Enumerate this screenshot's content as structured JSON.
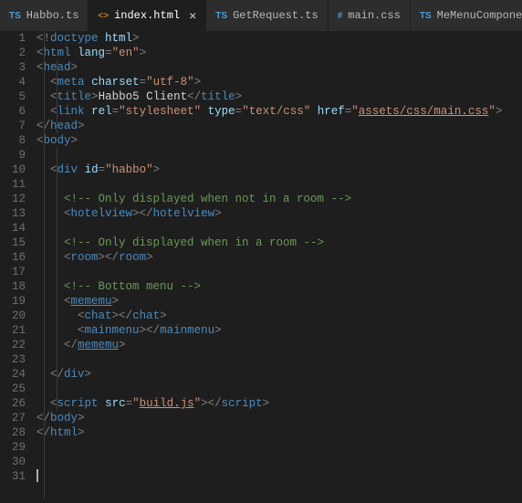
{
  "tabs": [
    {
      "icon_type": "ts",
      "icon_text": "TS",
      "label": "Habbo.ts",
      "active": false
    },
    {
      "icon_type": "html",
      "icon_text": "<>",
      "label": "index.html",
      "active": true
    },
    {
      "icon_type": "ts",
      "icon_text": "TS",
      "label": "GetRequest.ts",
      "active": false
    },
    {
      "icon_type": "css",
      "icon_text": "#",
      "label": "main.css",
      "active": false
    },
    {
      "icon_type": "ts",
      "icon_text": "TS",
      "label": "MeMenuComponent.ts",
      "active": false
    }
  ],
  "close_glyph": "×",
  "line_count": 31,
  "code": {
    "l1": "<!doctype html>",
    "l2": {
      "tag": "html",
      "attr": "lang",
      "val": "en"
    },
    "l3": {
      "tag": "head"
    },
    "l4": {
      "tag": "meta",
      "attr": "charset",
      "val": "utf-8"
    },
    "l5": {
      "tag": "title",
      "text": "Habbo5 Client"
    },
    "l6": {
      "tag": "link",
      "attr1": "rel",
      "val1": "stylesheet",
      "attr2": "type",
      "val2": "text/css",
      "attr3": "href",
      "val3": "assets/css/main.css"
    },
    "l7": {
      "tag_close": "head"
    },
    "l8": {
      "tag": "body"
    },
    "l10": {
      "tag": "div",
      "attr": "id",
      "val": "habbo"
    },
    "l12": "<!-- Only displayed when not in a room -->",
    "l13": {
      "tag": "hotelview"
    },
    "l15": "<!-- Only displayed when in a room -->",
    "l16": {
      "tag": "room"
    },
    "l18": "<!-- Bottom menu -->",
    "l19": {
      "tag": "mememu",
      "open": "mememu"
    },
    "l20": {
      "tag": "chat"
    },
    "l21": {
      "tag": "mainmenu"
    },
    "l22": {
      "tag_close": "mememu"
    },
    "l24": {
      "tag_close": "div"
    },
    "l26": {
      "tag": "script",
      "attr": "src",
      "val": "build.js"
    },
    "l27": {
      "tag_close": "body"
    },
    "l28": {
      "tag_close": "html"
    },
    "mememu_ul": "mememu"
  }
}
